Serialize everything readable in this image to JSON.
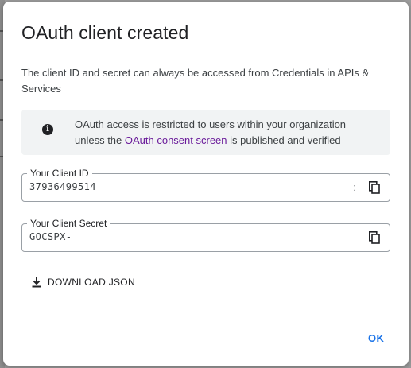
{
  "dialog": {
    "title": "OAuth client created",
    "description": "The client ID and secret can always be accessed from Credentials in APIs & Services",
    "info": {
      "icon": "info-icon",
      "text_before": "OAuth access is restricted to users within your organization unless the ",
      "link_text": "OAuth consent screen",
      "text_after": " is published and verified"
    },
    "client_id": {
      "label": "Your Client ID",
      "value": "37936499514",
      "suffix": ":",
      "copy_icon": "copy-icon"
    },
    "client_secret": {
      "label": "Your Client Secret",
      "value": "GOCSPX-",
      "copy_icon": "copy-icon"
    },
    "download_button": {
      "label": "DOWNLOAD JSON",
      "icon": "download-icon"
    },
    "ok_button": {
      "label": "OK"
    }
  },
  "colors": {
    "accent": "#1a73e8",
    "link": "#6a1b9a",
    "info_background": "#f1f3f4"
  }
}
